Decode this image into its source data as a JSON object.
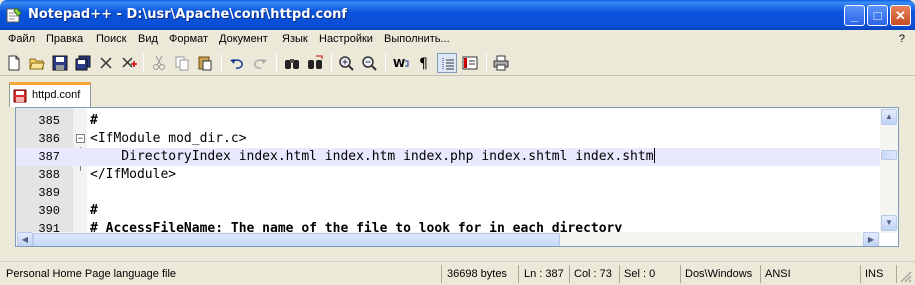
{
  "window": {
    "title": "Notepad++ - D:\\usr\\Apache\\conf\\httpd.conf",
    "minimize": "_",
    "maximize": "□",
    "close": "✕"
  },
  "menu": {
    "items": [
      "Файл",
      "Правка",
      "Поиск",
      "Вид",
      "Формат",
      "Документ",
      "Язык",
      "Настройки",
      "Выполнить..."
    ],
    "help": "?"
  },
  "toolbar": {
    "icons": [
      "new-file-icon",
      "open-file-icon",
      "save-icon",
      "save-all-icon",
      "close-file-icon",
      "close-all-icon",
      "cut-icon",
      "copy-icon",
      "paste-icon",
      "undo-icon",
      "redo-icon",
      "find-icon",
      "replace-icon",
      "zoom-in-icon",
      "zoom-out-icon",
      "word-wrap-icon",
      "show-all-chars-icon",
      "indent-guide-icon",
      "user-lang-icon",
      "print-icon"
    ]
  },
  "tab": {
    "label": "httpd.conf"
  },
  "editor": {
    "lines": [
      {
        "num": "385",
        "text": "#"
      },
      {
        "num": "386",
        "text": "<IfModule mod_dir.c>"
      },
      {
        "num": "387",
        "text": "    DirectoryIndex index.html index.htm index.php index.shtml index.shtm"
      },
      {
        "num": "388",
        "text": "</IfModule>"
      },
      {
        "num": "389",
        "text": ""
      },
      {
        "num": "390",
        "text": "#"
      },
      {
        "num": "391",
        "text": "# AccessFileName: The name of the file to look for in each directory"
      }
    ]
  },
  "status": {
    "language": "Personal Home Page language file",
    "size": "36698 bytes",
    "ln": "Ln : 387",
    "col": "Col : 73",
    "sel": "Sel : 0",
    "eol": "Dos\\Windows",
    "encoding": "ANSI",
    "mode": "INS"
  },
  "colors": {
    "titlebar": "#0a54dc",
    "current_line": "#e8e8ff",
    "tab_accent": "#f8a43a"
  }
}
